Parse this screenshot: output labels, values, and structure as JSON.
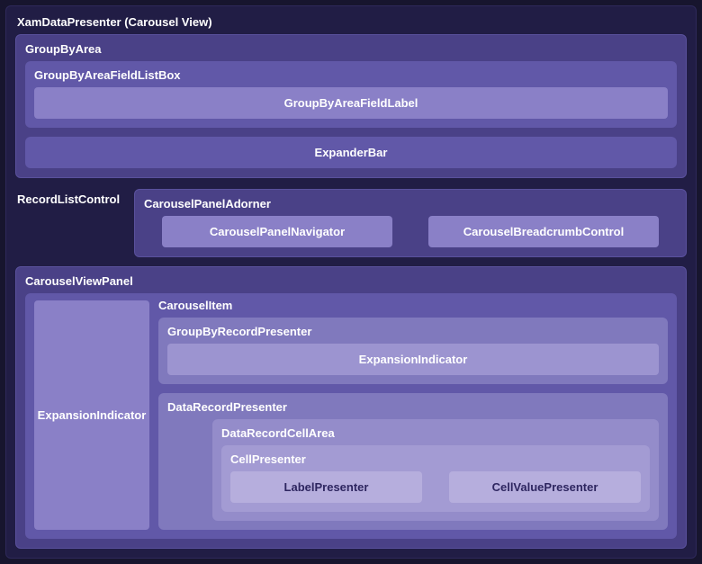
{
  "root": {
    "title": "XamDataPresenter (Carousel View)"
  },
  "groupByArea": {
    "title": "GroupByArea",
    "listBox": {
      "title": "GroupByAreaFieldListBox",
      "fieldLabel": "GroupByAreaFieldLabel"
    },
    "expanderBar": "ExpanderBar"
  },
  "recordListControl": {
    "title": "RecordListControl"
  },
  "adorner": {
    "title": "CarouselPanelAdorner",
    "navigator": "CarouselPanelNavigator",
    "breadcrumb": "CarouselBreadcrumbControl"
  },
  "carouselViewPanel": {
    "title": "CarouselViewPanel",
    "carouselItem": {
      "title": "CarouselItem",
      "expansionIndicator": "ExpansionIndicator",
      "groupByRecordPresenter": {
        "title": "GroupByRecordPresenter",
        "expansionIndicator": "ExpansionIndicator"
      },
      "dataRecordPresenter": {
        "title": "DataRecordPresenter",
        "cellArea": {
          "title": "DataRecordCellArea",
          "cellPresenter": {
            "title": "CellPresenter",
            "labelPresenter": "LabelPresenter",
            "cellValuePresenter": "CellValuePresenter"
          }
        }
      }
    }
  }
}
